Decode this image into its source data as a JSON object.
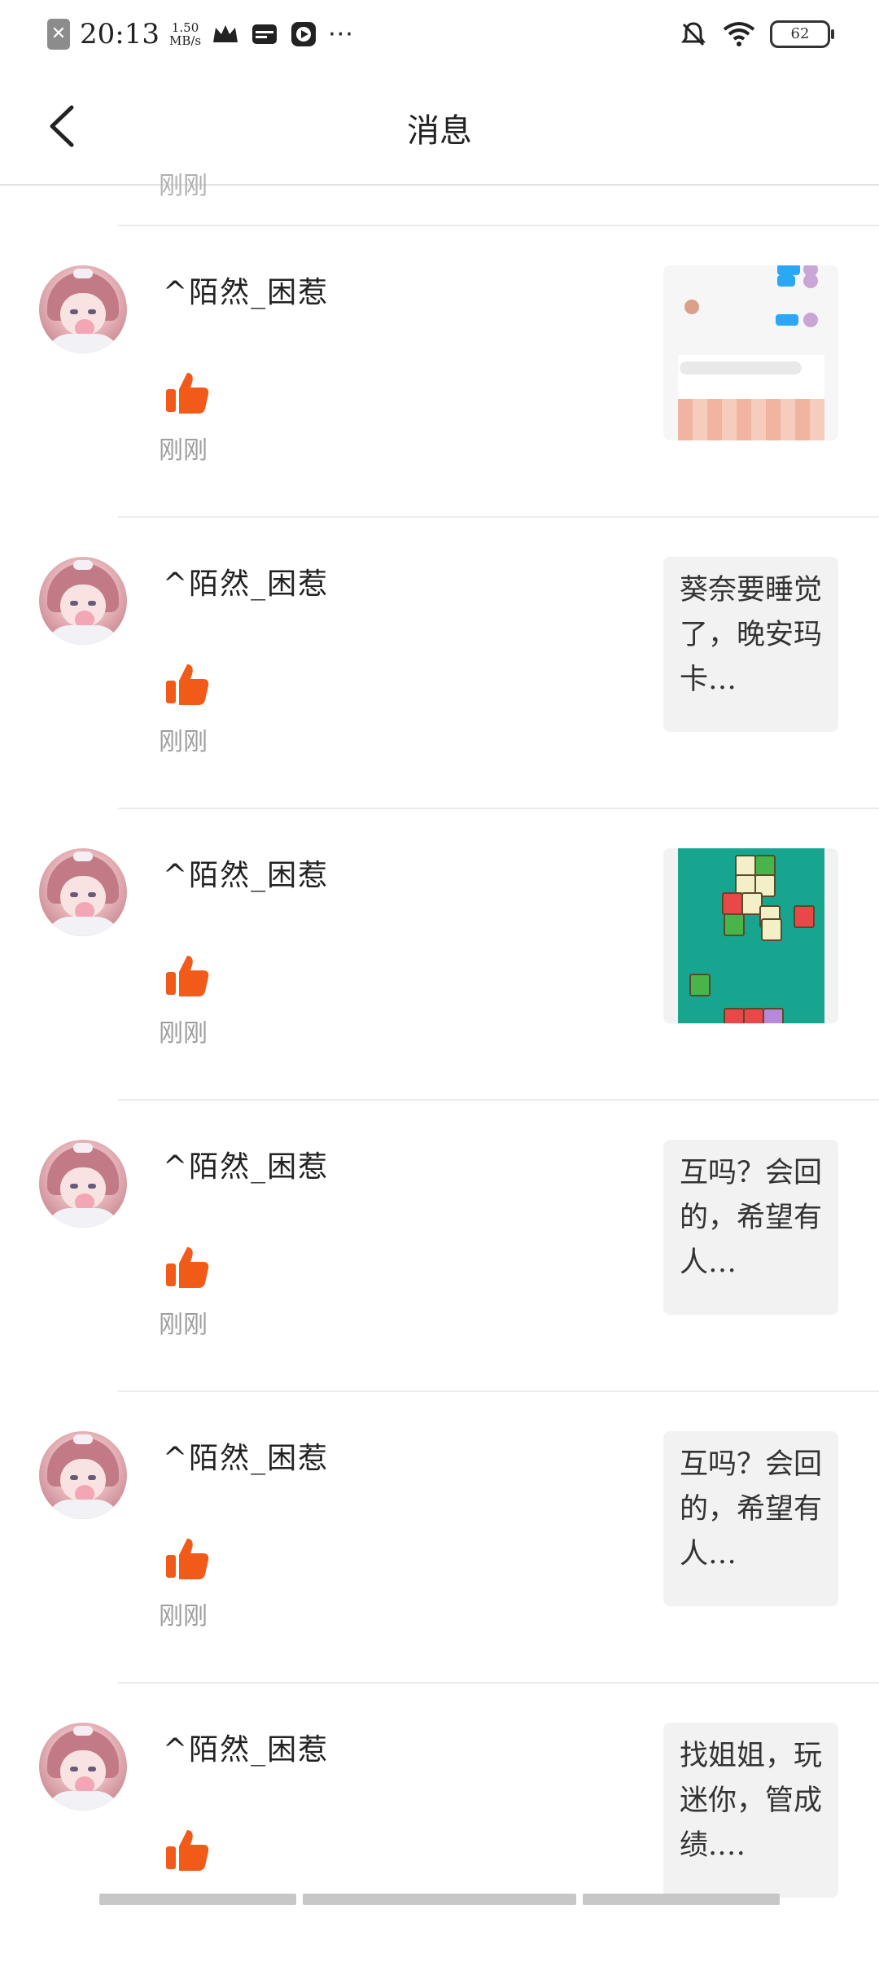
{
  "status_bar": {
    "time": "20:13",
    "speed_value": "1.50",
    "speed_unit": "MB/s",
    "more": "···",
    "battery": "62"
  },
  "header": {
    "title": "消息"
  },
  "partial_item": {
    "time": "刚刚"
  },
  "items": [
    {
      "username": "^陌然_困惹",
      "time": "刚刚",
      "preview_type": "image",
      "preview_text": ""
    },
    {
      "username": "^陌然_困惹",
      "time": "刚刚",
      "preview_type": "text",
      "preview_text": "葵奈要睡觉了，晚安玛卡…"
    },
    {
      "username": "^陌然_困惹",
      "time": "刚刚",
      "preview_type": "image",
      "preview_text": ""
    },
    {
      "username": "^陌然_困惹",
      "time": "刚刚",
      "preview_type": "text",
      "preview_text": "互吗？会回的，希望有人…"
    },
    {
      "username": "^陌然_困惹",
      "time": "刚刚",
      "preview_type": "text",
      "preview_text": "互吗？会回的，希望有人…"
    },
    {
      "username": "^陌然_困惹",
      "time": "",
      "preview_type": "text",
      "preview_text": "找姐姐，玩迷你，管成绩.…"
    }
  ],
  "colors": {
    "like_icon": "#f25a1a",
    "divider": "#ececec",
    "preview_bg": "#f2f2f2",
    "time_text": "#9e9e9e"
  }
}
